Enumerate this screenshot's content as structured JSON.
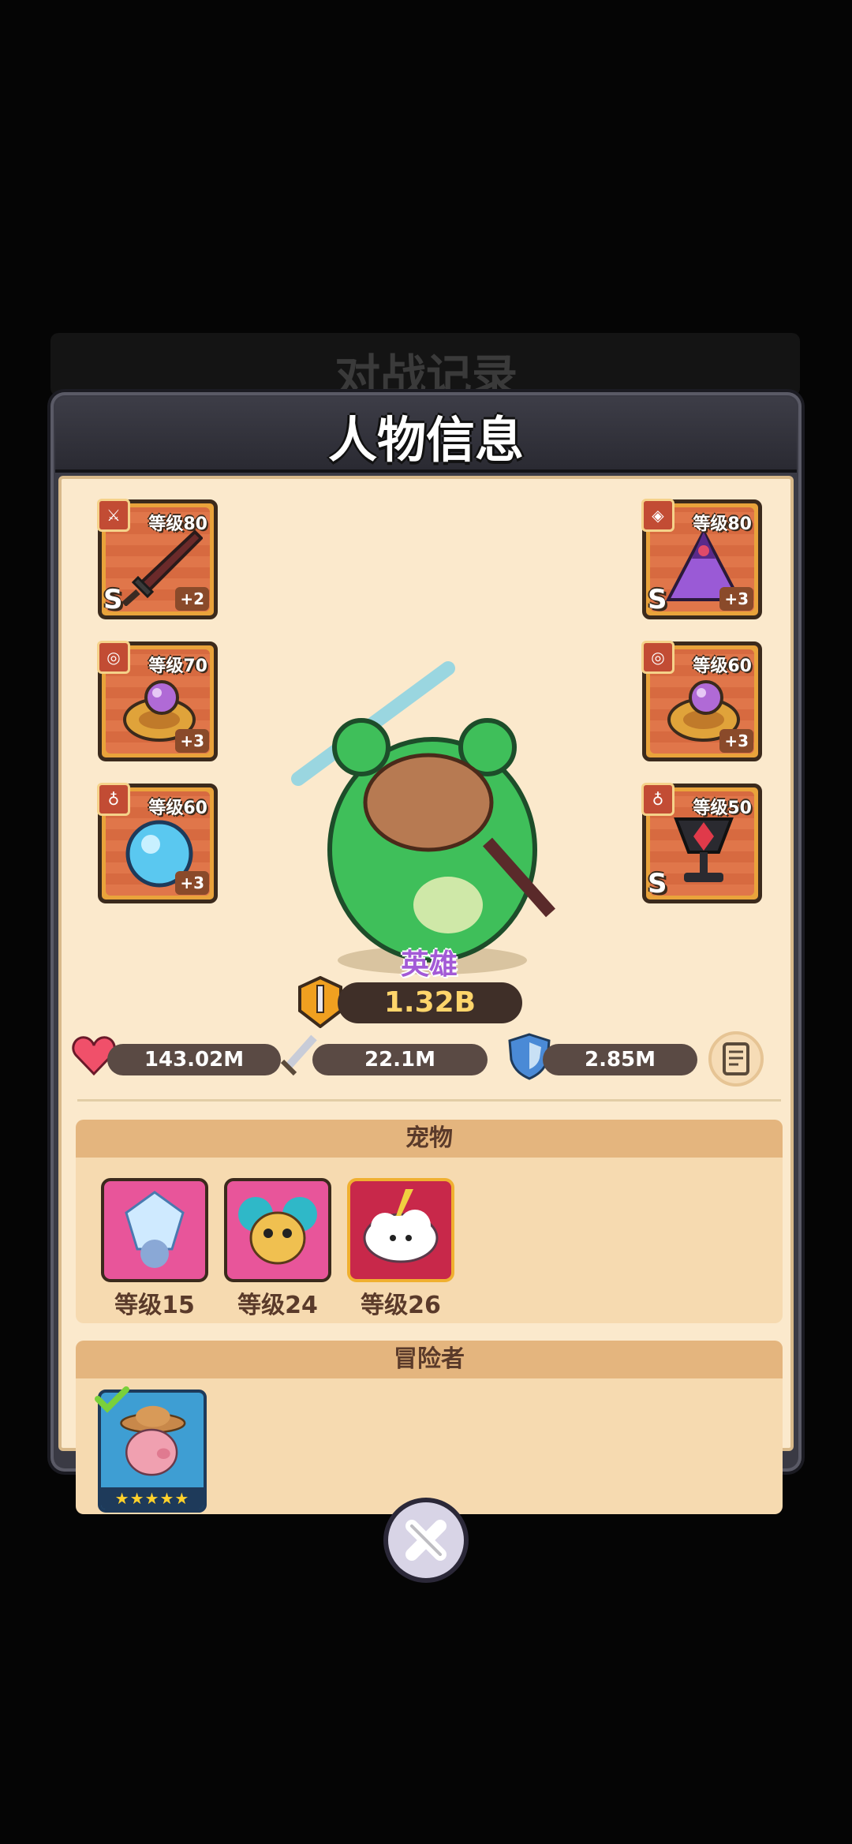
{
  "background": {
    "screen_title": "对战记录"
  },
  "modal": {
    "title": "人物信息"
  },
  "equipment": {
    "left": [
      {
        "level": "等级80",
        "plus": "+2",
        "grade": "S",
        "type_icon": "weapon-icon",
        "item": "sword-icon"
      },
      {
        "level": "等级70",
        "plus": "+3",
        "grade": "",
        "type_icon": "ring-icon",
        "item": "purple-ring-icon"
      },
      {
        "level": "等级60",
        "plus": "+3",
        "grade": "",
        "type_icon": "necklace-icon",
        "item": "blue-orb-icon"
      }
    ],
    "right": [
      {
        "level": "等级80",
        "plus": "+3",
        "grade": "S",
        "type_icon": "armor-icon",
        "item": "purple-cloak-icon"
      },
      {
        "level": "等级60",
        "plus": "+3",
        "grade": "",
        "type_icon": "ring-icon",
        "item": "purple-ring-icon"
      },
      {
        "level": "等级50",
        "plus": "",
        "grade": "S",
        "type_icon": "necklace-icon",
        "item": "dark-chalice-icon"
      }
    ]
  },
  "hero": {
    "rank": "英雄",
    "power": "1.32B"
  },
  "stats": {
    "hp": "143.02M",
    "attack": "22.1M",
    "defense": "2.85M"
  },
  "pets": {
    "title": "宠物",
    "items": [
      {
        "level": "等级15",
        "bg": "#e8559a"
      },
      {
        "level": "等级24",
        "bg": "#e8559a"
      },
      {
        "level": "等级26",
        "bg": "#c8284a"
      }
    ]
  },
  "adventurers": {
    "title": "冒险者",
    "items": [
      {
        "stars": "★★★★★"
      }
    ]
  }
}
